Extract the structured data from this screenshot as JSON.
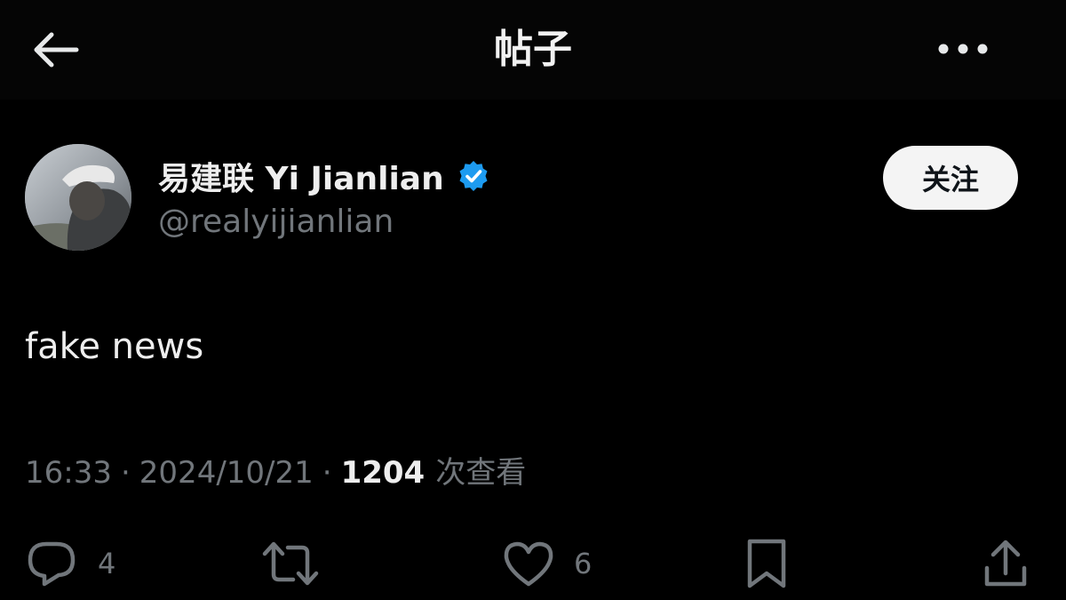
{
  "header": {
    "title": "帖子",
    "back_icon": "arrow-left-icon",
    "more_icon": "more-horizontal-icon"
  },
  "author": {
    "display_name": "易建联 Yi Jianlian",
    "handle": "@realyijianlian",
    "verified": true,
    "verified_color": "#1d9bf0",
    "follow_label": "关注"
  },
  "post": {
    "text": "fake news",
    "time": "16:33",
    "date": "2024/10/21",
    "separator": "·",
    "views_count": "1204",
    "views_label": "次查看"
  },
  "actions": {
    "reply": {
      "icon": "reply-icon",
      "count": "4"
    },
    "repost": {
      "icon": "repost-icon"
    },
    "like": {
      "icon": "heart-icon",
      "count": "6"
    },
    "bookmark": {
      "icon": "bookmark-icon"
    },
    "share": {
      "icon": "share-icon"
    }
  },
  "colors": {
    "background": "#000000",
    "text_primary": "#eeeeee",
    "text_secondary": "#71767b",
    "accent": "#1d9bf0"
  }
}
